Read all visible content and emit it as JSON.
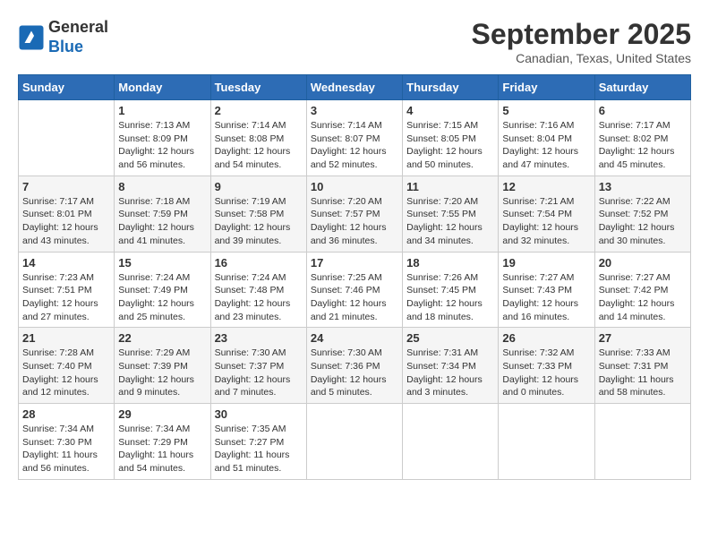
{
  "header": {
    "logo_line1": "General",
    "logo_line2": "Blue",
    "month": "September 2025",
    "location": "Canadian, Texas, United States"
  },
  "days_of_week": [
    "Sunday",
    "Monday",
    "Tuesday",
    "Wednesday",
    "Thursday",
    "Friday",
    "Saturday"
  ],
  "weeks": [
    [
      {
        "day": "",
        "info": ""
      },
      {
        "day": "1",
        "info": "Sunrise: 7:13 AM\nSunset: 8:09 PM\nDaylight: 12 hours and 56 minutes."
      },
      {
        "day": "2",
        "info": "Sunrise: 7:14 AM\nSunset: 8:08 PM\nDaylight: 12 hours and 54 minutes."
      },
      {
        "day": "3",
        "info": "Sunrise: 7:14 AM\nSunset: 8:07 PM\nDaylight: 12 hours and 52 minutes."
      },
      {
        "day": "4",
        "info": "Sunrise: 7:15 AM\nSunset: 8:05 PM\nDaylight: 12 hours and 50 minutes."
      },
      {
        "day": "5",
        "info": "Sunrise: 7:16 AM\nSunset: 8:04 PM\nDaylight: 12 hours and 47 minutes."
      },
      {
        "day": "6",
        "info": "Sunrise: 7:17 AM\nSunset: 8:02 PM\nDaylight: 12 hours and 45 minutes."
      }
    ],
    [
      {
        "day": "7",
        "info": "Sunrise: 7:17 AM\nSunset: 8:01 PM\nDaylight: 12 hours and 43 minutes."
      },
      {
        "day": "8",
        "info": "Sunrise: 7:18 AM\nSunset: 7:59 PM\nDaylight: 12 hours and 41 minutes."
      },
      {
        "day": "9",
        "info": "Sunrise: 7:19 AM\nSunset: 7:58 PM\nDaylight: 12 hours and 39 minutes."
      },
      {
        "day": "10",
        "info": "Sunrise: 7:20 AM\nSunset: 7:57 PM\nDaylight: 12 hours and 36 minutes."
      },
      {
        "day": "11",
        "info": "Sunrise: 7:20 AM\nSunset: 7:55 PM\nDaylight: 12 hours and 34 minutes."
      },
      {
        "day": "12",
        "info": "Sunrise: 7:21 AM\nSunset: 7:54 PM\nDaylight: 12 hours and 32 minutes."
      },
      {
        "day": "13",
        "info": "Sunrise: 7:22 AM\nSunset: 7:52 PM\nDaylight: 12 hours and 30 minutes."
      }
    ],
    [
      {
        "day": "14",
        "info": "Sunrise: 7:23 AM\nSunset: 7:51 PM\nDaylight: 12 hours and 27 minutes."
      },
      {
        "day": "15",
        "info": "Sunrise: 7:24 AM\nSunset: 7:49 PM\nDaylight: 12 hours and 25 minutes."
      },
      {
        "day": "16",
        "info": "Sunrise: 7:24 AM\nSunset: 7:48 PM\nDaylight: 12 hours and 23 minutes."
      },
      {
        "day": "17",
        "info": "Sunrise: 7:25 AM\nSunset: 7:46 PM\nDaylight: 12 hours and 21 minutes."
      },
      {
        "day": "18",
        "info": "Sunrise: 7:26 AM\nSunset: 7:45 PM\nDaylight: 12 hours and 18 minutes."
      },
      {
        "day": "19",
        "info": "Sunrise: 7:27 AM\nSunset: 7:43 PM\nDaylight: 12 hours and 16 minutes."
      },
      {
        "day": "20",
        "info": "Sunrise: 7:27 AM\nSunset: 7:42 PM\nDaylight: 12 hours and 14 minutes."
      }
    ],
    [
      {
        "day": "21",
        "info": "Sunrise: 7:28 AM\nSunset: 7:40 PM\nDaylight: 12 hours and 12 minutes."
      },
      {
        "day": "22",
        "info": "Sunrise: 7:29 AM\nSunset: 7:39 PM\nDaylight: 12 hours and 9 minutes."
      },
      {
        "day": "23",
        "info": "Sunrise: 7:30 AM\nSunset: 7:37 PM\nDaylight: 12 hours and 7 minutes."
      },
      {
        "day": "24",
        "info": "Sunrise: 7:30 AM\nSunset: 7:36 PM\nDaylight: 12 hours and 5 minutes."
      },
      {
        "day": "25",
        "info": "Sunrise: 7:31 AM\nSunset: 7:34 PM\nDaylight: 12 hours and 3 minutes."
      },
      {
        "day": "26",
        "info": "Sunrise: 7:32 AM\nSunset: 7:33 PM\nDaylight: 12 hours and 0 minutes."
      },
      {
        "day": "27",
        "info": "Sunrise: 7:33 AM\nSunset: 7:31 PM\nDaylight: 11 hours and 58 minutes."
      }
    ],
    [
      {
        "day": "28",
        "info": "Sunrise: 7:34 AM\nSunset: 7:30 PM\nDaylight: 11 hours and 56 minutes."
      },
      {
        "day": "29",
        "info": "Sunrise: 7:34 AM\nSunset: 7:29 PM\nDaylight: 11 hours and 54 minutes."
      },
      {
        "day": "30",
        "info": "Sunrise: 7:35 AM\nSunset: 7:27 PM\nDaylight: 11 hours and 51 minutes."
      },
      {
        "day": "",
        "info": ""
      },
      {
        "day": "",
        "info": ""
      },
      {
        "day": "",
        "info": ""
      },
      {
        "day": "",
        "info": ""
      }
    ]
  ]
}
